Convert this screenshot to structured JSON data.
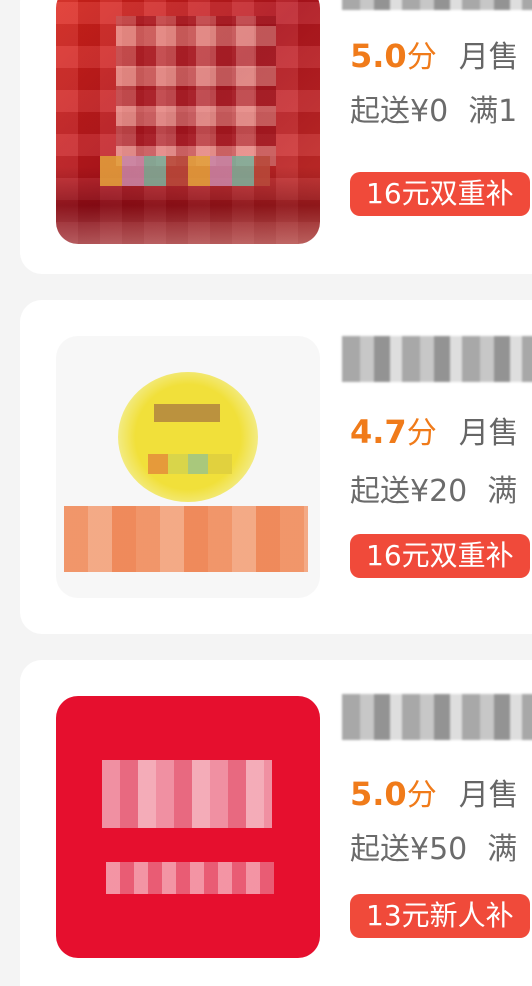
{
  "shops": [
    {
      "rating_value": "5.0",
      "rating_unit": "分",
      "sales_text": "月售",
      "min_order": "起送¥0",
      "delivery_fee": "满1",
      "promo_badge": "16元双重补"
    },
    {
      "rating_value": "4.7",
      "rating_unit": "分",
      "sales_text": "月售",
      "min_order": "起送¥20",
      "delivery_fee": "满",
      "promo_badge": "16元双重补"
    },
    {
      "rating_value": "5.0",
      "rating_unit": "分",
      "sales_text": "月售",
      "min_order": "起送¥50",
      "delivery_fee": "满",
      "promo_badge": "13元新人补"
    }
  ],
  "colors": {
    "rating": "#f07b1a",
    "badge_bg": "#f04a3a",
    "page_bg": "#f4f4f4"
  }
}
